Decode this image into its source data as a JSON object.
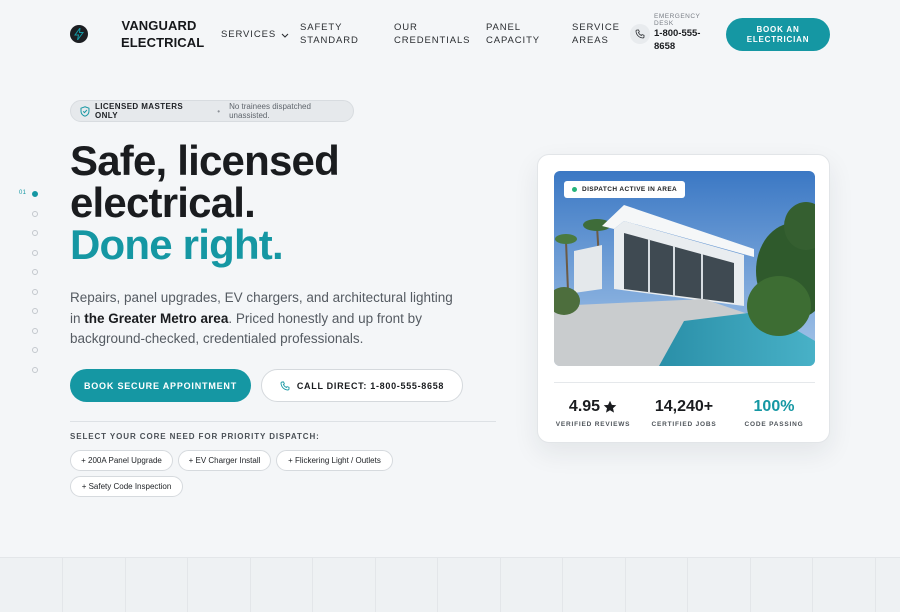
{
  "header": {
    "brand_line1": "VANGUARD",
    "brand_line2": "ELECTRICAL",
    "logo_icon": "lightning-bolt-icon",
    "nav": {
      "services": "SERVICES",
      "safety": "SAFETY STANDARD",
      "credentials": "OUR CREDENTIALS",
      "panel": "PANEL CAPACITY",
      "areas": "SERVICE AREAS"
    },
    "emergency_label": "EMERGENCY DESK",
    "emergency_number": "1-800-555-8658",
    "book_button": "BOOK AN ELECTRICIAN"
  },
  "side_nav": {
    "index_label": "01",
    "dot_count": 10
  },
  "hero": {
    "badge_strong": "LICENSED MASTERS ONLY",
    "badge_muted": "No trainees dispatched unassisted.",
    "headline_line1": "Safe, licensed",
    "headline_line2": "electrical.",
    "headline_accent": "Done right.",
    "sub_before": "Repairs, panel upgrades, EV chargers, and architectural lighting in ",
    "sub_bold": "the Greater Metro area",
    "sub_after": ". Priced honestly and up front by background-checked, credentialed professionals.",
    "primary_button": "BOOK SECURE APPOINTMENT",
    "call_button": "CALL DIRECT: 1-800-555-8658",
    "need_label": "SELECT YOUR CORE NEED FOR PRIORITY DISPATCH:",
    "chips": [
      "+ 200A Panel Upgrade",
      "+ EV Charger Install",
      "+ Flickering Light / Outlets",
      "+ Safety Code Inspection"
    ]
  },
  "card": {
    "status": "DISPATCH ACTIVE IN AREA",
    "stats": [
      {
        "value": "4.95",
        "label": "VERIFIED REVIEWS",
        "icon": "star-icon"
      },
      {
        "value": "14,240+",
        "label": "CERTIFIED JOBS"
      },
      {
        "value": "100%",
        "label": "CODE PASSING"
      }
    ]
  },
  "colors": {
    "accent": "#1597a3",
    "background": "#f4f6f8",
    "status_green": "#25b37a"
  }
}
